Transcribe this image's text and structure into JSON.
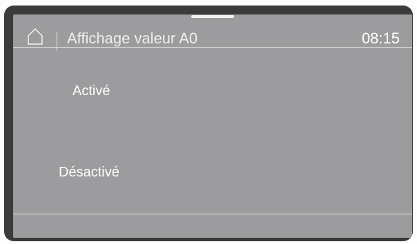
{
  "header": {
    "icon": "home-icon",
    "title": "Affichage valeur A0",
    "time": "08:15"
  },
  "options": [
    {
      "label": "Activé"
    },
    {
      "label": "Désactivé"
    }
  ]
}
